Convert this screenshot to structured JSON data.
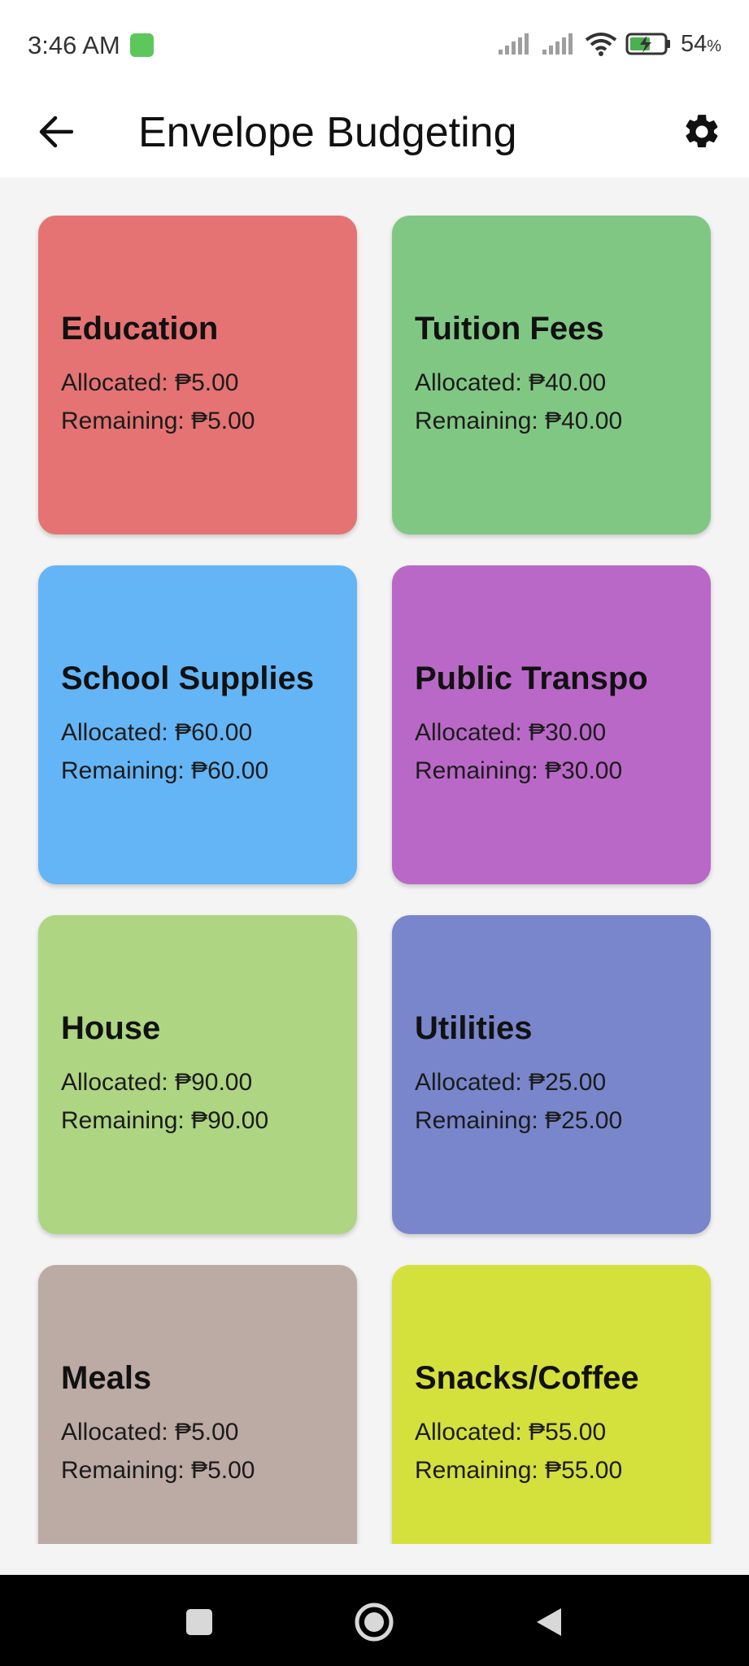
{
  "status_bar": {
    "time": "3:46 AM",
    "battery_percent": "54",
    "battery_unit": "%",
    "icons": [
      "app-notification-icon",
      "signal-icon",
      "signal-icon",
      "wifi-icon",
      "battery-charging-icon"
    ]
  },
  "app_bar": {
    "title": "Envelope Budgeting",
    "back_icon": "arrow-left-icon",
    "settings_icon": "gear-icon"
  },
  "envelopes": [
    {
      "name": "Education",
      "allocated": "Allocated: ₱5.00",
      "remaining": "Remaining: ₱5.00",
      "color": "#e57373"
    },
    {
      "name": "Tuition Fees",
      "allocated": "Allocated: ₱40.00",
      "remaining": "Remaining: ₱40.00",
      "color": "#81c784"
    },
    {
      "name": "School Supplies",
      "allocated": "Allocated: ₱60.00",
      "remaining": "Remaining: ₱60.00",
      "color": "#64b5f6"
    },
    {
      "name": "Public Transpo",
      "allocated": "Allocated: ₱30.00",
      "remaining": "Remaining: ₱30.00",
      "color": "#ba68c8"
    },
    {
      "name": "House",
      "allocated": "Allocated: ₱90.00",
      "remaining": "Remaining: ₱90.00",
      "color": "#aed581"
    },
    {
      "name": "Utilities",
      "allocated": "Allocated: ₱25.00",
      "remaining": "Remaining: ₱25.00",
      "color": "#7986cb"
    },
    {
      "name": "Meals",
      "allocated": "Allocated: ₱5.00",
      "remaining": "Remaining: ₱5.00",
      "color": "#bcaaa4"
    },
    {
      "name": "Snacks/Coffee",
      "allocated": "Allocated: ₱55.00",
      "remaining": "Remaining: ₱55.00",
      "color": "#d4e03c"
    }
  ],
  "nav_bar": {
    "icons": [
      "recents-square-icon",
      "home-circle-icon",
      "back-triangle-icon"
    ]
  }
}
